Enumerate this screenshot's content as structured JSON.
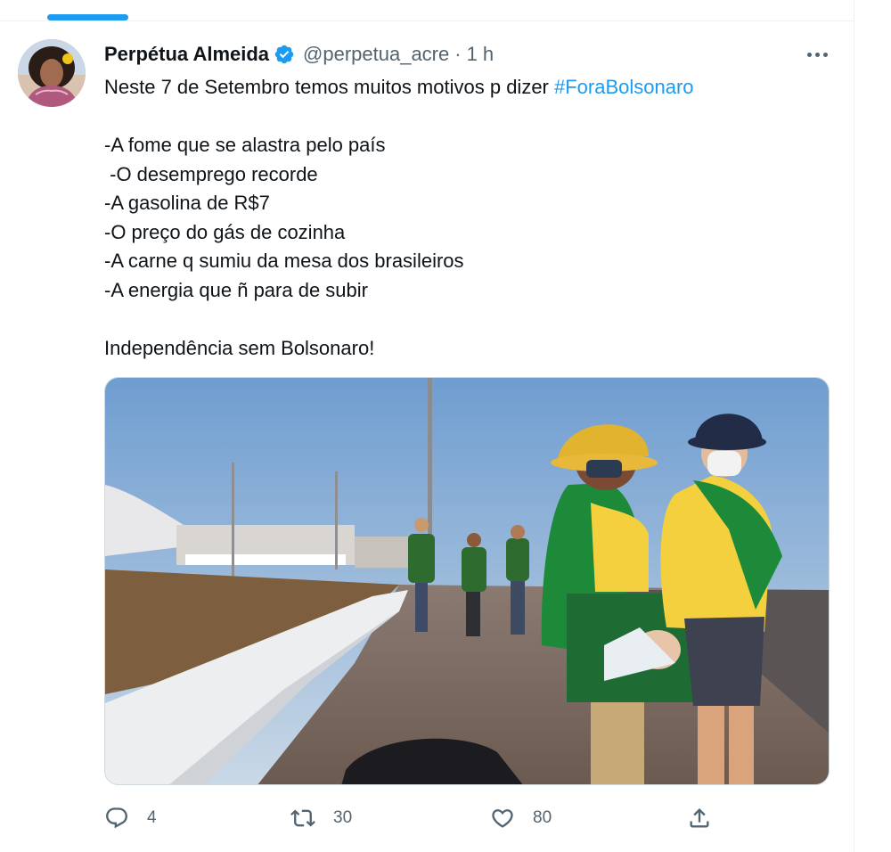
{
  "tweet": {
    "author": {
      "display_name": "Perpétua Almeida",
      "handle": "@perpetua_acre",
      "verified": true
    },
    "separator": "·",
    "time": "1 h",
    "text_intro": "Neste 7 de Setembro temos muitos motivos p dizer ",
    "hashtag": "#ForaBolsonaro",
    "text_body": "\n\n-A fome que se alastra pelo país\n -O desemprego recorde\n-A gasolina de R$7\n-O preço do gás de cozinha\n-A carne q sumiu da mesa dos brasileiros\n-A energia que ñ para de subir\n\nIndependência sem Bolsonaro!",
    "media": {
      "description": "photo"
    },
    "actions": {
      "reply_count": "4",
      "retweet_count": "30",
      "like_count": "80"
    }
  },
  "colors": {
    "accent": "#1d9bf0",
    "text_primary": "#0f1419",
    "text_secondary": "#536471"
  },
  "icons": {
    "verified": "verified-badge-icon",
    "more": "more-dots-icon",
    "reply": "reply-icon",
    "retweet": "retweet-icon",
    "like": "heart-icon",
    "share": "share-icon"
  }
}
